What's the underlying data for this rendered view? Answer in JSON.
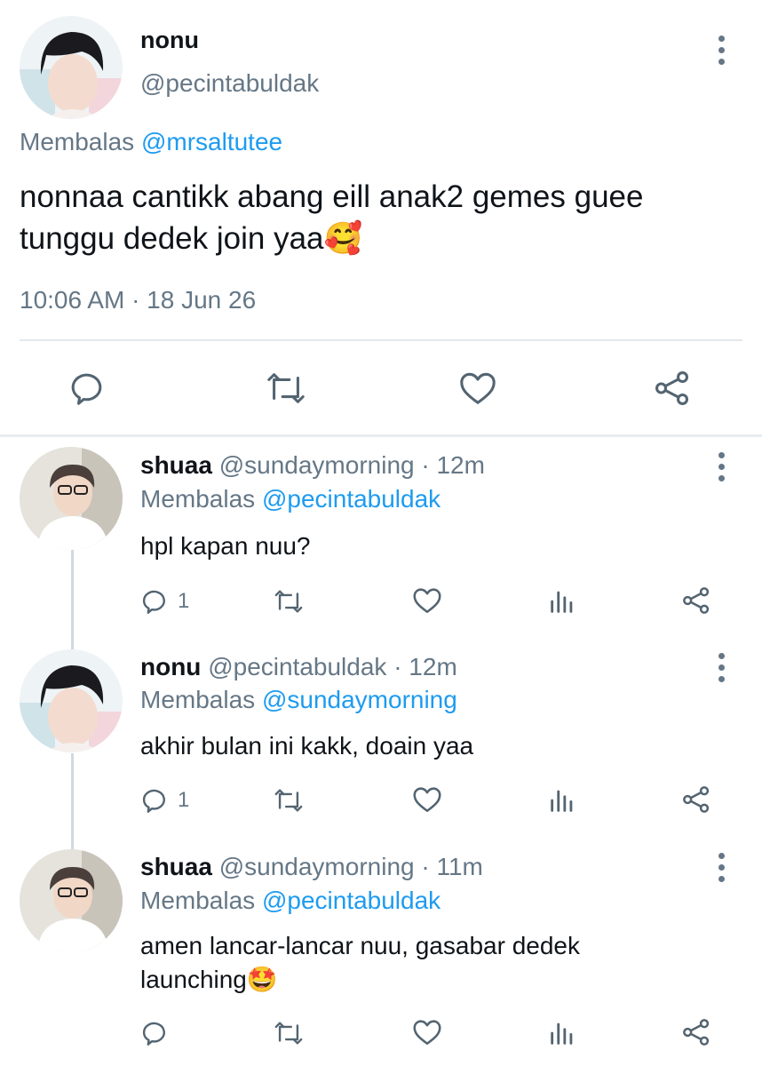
{
  "main_tweet": {
    "display_name": "nonu",
    "handle": "@pecintabuldak",
    "reply_prefix": "Membalas",
    "reply_to": "@mrsaltutee",
    "text": "nonnaa cantikk abang eill anak2 gemes guee tunggu dedek join yaa",
    "emoji": "🥰",
    "timestamp": "10:06 AM · 18 Jun 26"
  },
  "replies": [
    {
      "display_name": "shuaa",
      "handle_time": "@sundaymorning · 12m",
      "reply_prefix": "Membalas",
      "reply_to": "@pecintabuldak",
      "text": "hpl kapan nuu?",
      "reply_count": "1"
    },
    {
      "display_name": "nonu",
      "handle_time": "@pecintabuldak · 12m",
      "reply_prefix": "Membalas",
      "reply_to": "@sundaymorning",
      "text": "akhir bulan ini kakk, doain yaa",
      "reply_count": "1"
    },
    {
      "display_name": "shuaa",
      "handle_time": "@sundaymorning · 11m",
      "reply_prefix": "Membalas",
      "reply_to": "@pecintabuldak",
      "text": "amen lancar-lancar nuu, gasabar dedek launching",
      "emoji": "🤩",
      "reply_count": ""
    }
  ],
  "colors": {
    "link": "#1d9bf0",
    "secondary_text": "#657786",
    "icon": "#536471",
    "divider": "#e1e8ed",
    "thread_line": "#cfd9de"
  },
  "icons": {
    "reply": "speech-bubble-icon",
    "retweet": "retweet-icon",
    "like": "heart-icon",
    "analytics": "bar-chart-icon",
    "share": "share-icon",
    "more": "vertical-ellipsis-icon"
  }
}
